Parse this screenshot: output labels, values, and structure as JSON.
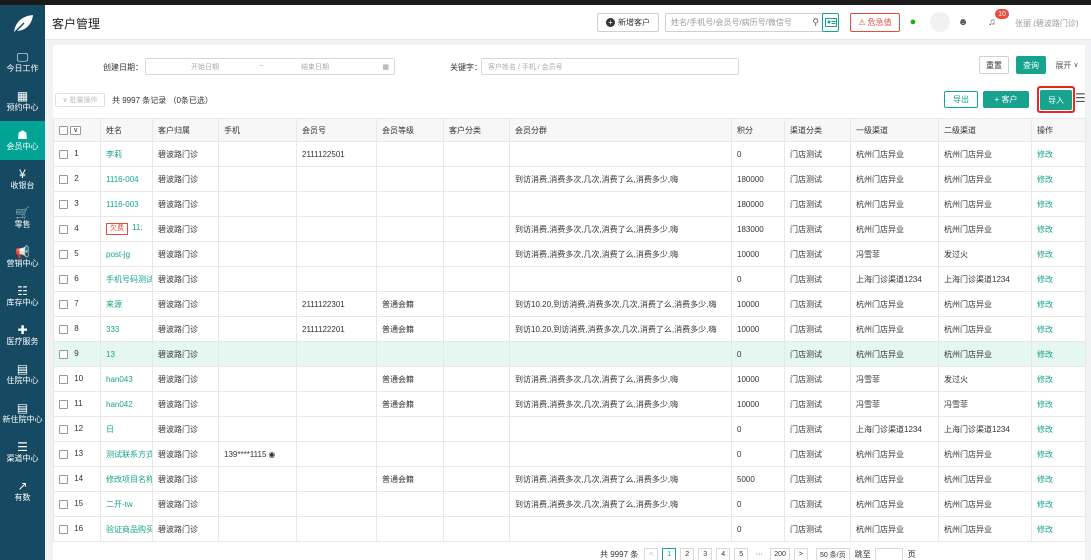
{
  "sidebar": {
    "items": [
      {
        "label": "今日工作",
        "icon": "monitor-icon"
      },
      {
        "label": "预约中心",
        "icon": "calendar-icon"
      },
      {
        "label": "会员中心",
        "icon": "members-icon"
      },
      {
        "label": "收银台",
        "icon": "yen-icon"
      },
      {
        "label": "零售",
        "icon": "cart-icon"
      },
      {
        "label": "营销中心",
        "icon": "megaphone-icon"
      },
      {
        "label": "库存中心",
        "icon": "grid-icon"
      },
      {
        "label": "医疗服务",
        "icon": "medical-kit-icon"
      },
      {
        "label": "住院中心",
        "icon": "hospital-icon"
      },
      {
        "label": "新住院中心",
        "icon": "hospital-new-icon"
      },
      {
        "label": "渠道中心",
        "icon": "org-chart-icon"
      },
      {
        "label": "有数",
        "icon": "line-chart-icon"
      }
    ]
  },
  "header": {
    "title": "客户管理",
    "new_customer": "新增客户",
    "search_placeholder": "姓名/手机号/会员号/病历号/微信号",
    "emergency": "危急值",
    "notif_count": "10",
    "user_name": "张丽 (碧波路门诊)"
  },
  "filters": {
    "created_date_label": "创建日期：",
    "start_placeholder": "开始日期",
    "range_sep": "~",
    "end_placeholder": "结束日期",
    "keyword_label": "关键字：",
    "keyword_placeholder": "客户姓名 / 手机 / 会员号",
    "reset": "重置",
    "query": "查询",
    "expand": "展开"
  },
  "toolbar": {
    "batch": "批量操作",
    "summary": "共 9997 条记录 （0条已选）",
    "export": "导出",
    "add_customer": "+ 客户",
    "import": "导入"
  },
  "table": {
    "columns": [
      "",
      "姓名",
      "客户归属",
      "手机",
      "会员号",
      "会员等级",
      "客户分类",
      "会员分群",
      "积分",
      "渠道分类",
      "一级渠道",
      "二级渠道",
      "操作"
    ],
    "rows": [
      {
        "no": "1",
        "name": "李莉",
        "owe": "",
        "belong": "碧波路门诊",
        "phone": "",
        "member_no": "2111122501",
        "level": "",
        "category": "",
        "group": "",
        "points": "0",
        "channel_type": "门店测试",
        "channel1": "杭州门店异业",
        "channel2": "杭州门店异业",
        "action": "修改"
      },
      {
        "no": "2",
        "name": "1116-004",
        "owe": "",
        "belong": "碧波路门诊",
        "phone": "",
        "member_no": "",
        "level": "",
        "category": "",
        "group": "到访消费,消费多次,几次,消费了么,消费多少,嗨",
        "points": "180000",
        "channel_type": "门店测试",
        "channel1": "杭州门店异业",
        "channel2": "杭州门店异业",
        "action": "修改"
      },
      {
        "no": "3",
        "name": "1116-003",
        "owe": "",
        "belong": "碧波路门诊",
        "phone": "",
        "member_no": "",
        "level": "",
        "category": "",
        "group": "",
        "points": "180000",
        "channel_type": "门店测试",
        "channel1": "杭州门店异业",
        "channel2": "杭州门店异业",
        "action": "修改"
      },
      {
        "no": "4",
        "name": "11:",
        "owe": "欠费",
        "belong": "碧波路门诊",
        "phone": "",
        "member_no": "",
        "level": "",
        "category": "",
        "group": "到访消费,消费多次,几次,消费了么,消费多少,嗨",
        "points": "183000",
        "channel_type": "门店测试",
        "channel1": "杭州门店异业",
        "channel2": "杭州门店异业",
        "action": "修改"
      },
      {
        "no": "5",
        "name": "post-jg",
        "owe": "",
        "belong": "碧波路门诊",
        "phone": "",
        "member_no": "",
        "level": "",
        "category": "",
        "group": "到访消费,消费多次,几次,消费了么,消费多少,嗨",
        "points": "10000",
        "channel_type": "门店测试",
        "channel1": "冯雪菲",
        "channel2": "发过火",
        "action": "修改"
      },
      {
        "no": "6",
        "name": "手机号码测试",
        "owe": "",
        "belong": "碧波路门诊",
        "phone": "",
        "member_no": "",
        "level": "",
        "category": "",
        "group": "",
        "points": "0",
        "channel_type": "门店测试",
        "channel1": "上海门诊渠道1234",
        "channel2": "上海门诊渠道1234",
        "action": "修改"
      },
      {
        "no": "7",
        "name": "来源",
        "owe": "",
        "belong": "碧波路门诊",
        "phone": "",
        "member_no": "2111122301",
        "level": "普通会籍",
        "category": "",
        "group": "到访10.20,到访消费,消费多次,几次,消费了么,消费多少,嗨",
        "points": "10000",
        "channel_type": "门店测试",
        "channel1": "杭州门店异业",
        "channel2": "杭州门店异业",
        "action": "修改"
      },
      {
        "no": "8",
        "name": "333",
        "owe": "",
        "belong": "碧波路门诊",
        "phone": "",
        "member_no": "2111122201",
        "level": "普通会籍",
        "category": "",
        "group": "到访10.20,到访消费,消费多次,几次,消费了么,消费多少,嗨",
        "points": "10000",
        "channel_type": "门店测试",
        "channel1": "杭州门店异业",
        "channel2": "杭州门店异业",
        "action": "修改"
      },
      {
        "no": "9",
        "name": "13",
        "owe": "",
        "belong": "碧波路门诊",
        "phone": "",
        "member_no": "",
        "level": "",
        "category": "",
        "group": "",
        "points": "0",
        "channel_type": "门店测试",
        "channel1": "杭州门店异业",
        "channel2": "杭州门店异业",
        "action": "修改"
      },
      {
        "no": "10",
        "name": "han043",
        "owe": "",
        "belong": "碧波路门诊",
        "phone": "",
        "member_no": "",
        "level": "普通会籍",
        "category": "",
        "group": "到访消费,消费多次,几次,消费了么,消费多少,嗨",
        "points": "10000",
        "channel_type": "门店测试",
        "channel1": "冯雪菲",
        "channel2": "发过火",
        "action": "修改"
      },
      {
        "no": "11",
        "name": "han042",
        "owe": "",
        "belong": "碧波路门诊",
        "phone": "",
        "member_no": "",
        "level": "普通会籍",
        "category": "",
        "group": "到访消费,消费多次,几次,消费了么,消费多少,嗨",
        "points": "10000",
        "channel_type": "门店测试",
        "channel1": "冯雪菲",
        "channel2": "冯雪菲",
        "action": "修改"
      },
      {
        "no": "12",
        "name": "日",
        "owe": "",
        "belong": "碧波路门诊",
        "phone": "",
        "member_no": "",
        "level": "",
        "category": "",
        "group": "",
        "points": "0",
        "channel_type": "门店测试",
        "channel1": "上海门诊渠道1234",
        "channel2": "上海门诊渠道1234",
        "action": "修改"
      },
      {
        "no": "13",
        "name": "测试联系方式",
        "owe": "",
        "belong": "碧波路门诊",
        "phone": "139****1115",
        "member_no": "",
        "level": "",
        "category": "",
        "group": "",
        "points": "0",
        "channel_type": "门店测试",
        "channel1": "杭州门店异业",
        "channel2": "杭州门店异业",
        "action": "修改"
      },
      {
        "no": "14",
        "name": "修改项目名称",
        "owe": "",
        "belong": "碧波路门诊",
        "phone": "",
        "member_no": "",
        "level": "普通会籍",
        "category": "",
        "group": "到访消费,消费多次,几次,消费了么,消费多少,嗨",
        "points": "5000",
        "channel_type": "门店测试",
        "channel1": "杭州门店异业",
        "channel2": "杭州门店异业",
        "action": "修改"
      },
      {
        "no": "15",
        "name": "二开-tw",
        "owe": "",
        "belong": "碧波路门诊",
        "phone": "",
        "member_no": "",
        "level": "",
        "category": "",
        "group": "到访消费,消费多次,几次,消费了么,消费多少,嗨",
        "points": "0",
        "channel_type": "门店测试",
        "channel1": "杭州门店异业",
        "channel2": "杭州门店异业",
        "action": "修改"
      },
      {
        "no": "16",
        "name": "验证商品购买",
        "owe": "",
        "belong": "碧波路门诊",
        "phone": "",
        "member_no": "",
        "level": "",
        "category": "",
        "group": "",
        "points": "0",
        "channel_type": "门店测试",
        "channel1": "杭州门店异业",
        "channel2": "杭州门店异业",
        "action": "修改"
      }
    ]
  },
  "pagination": {
    "total": "共 9997 条",
    "prev": "<",
    "pages": [
      "1",
      "2",
      "3",
      "4",
      "5"
    ],
    "ellipsis": "···",
    "last": "200",
    "next": ">",
    "per_page": "50 条/页",
    "goto": "跳至",
    "page_unit": "页"
  },
  "colors": {
    "sidebar": "#164a63",
    "accent": "#00a394",
    "danger": "#e74c3c"
  }
}
